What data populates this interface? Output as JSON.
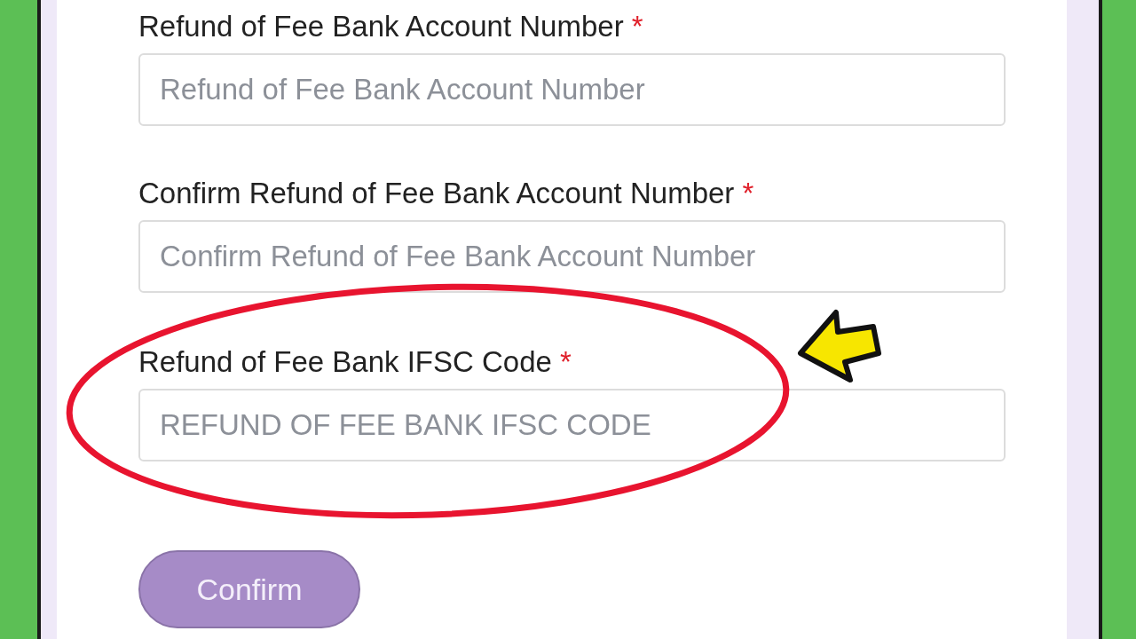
{
  "fields": [
    {
      "label": "Refund of Fee Bank Account Number",
      "required_mark": "*",
      "placeholder": "Refund of Fee Bank Account Number"
    },
    {
      "label": "Confirm Refund of Fee Bank Account Number",
      "required_mark": "*",
      "placeholder": "Confirm Refund of Fee Bank Account Number"
    },
    {
      "label": "Refund of Fee Bank IFSC Code",
      "required_mark": "*",
      "placeholder": "REFUND OF FEE BANK IFSC CODE"
    }
  ],
  "confirm_button": {
    "label": "Confirm"
  }
}
